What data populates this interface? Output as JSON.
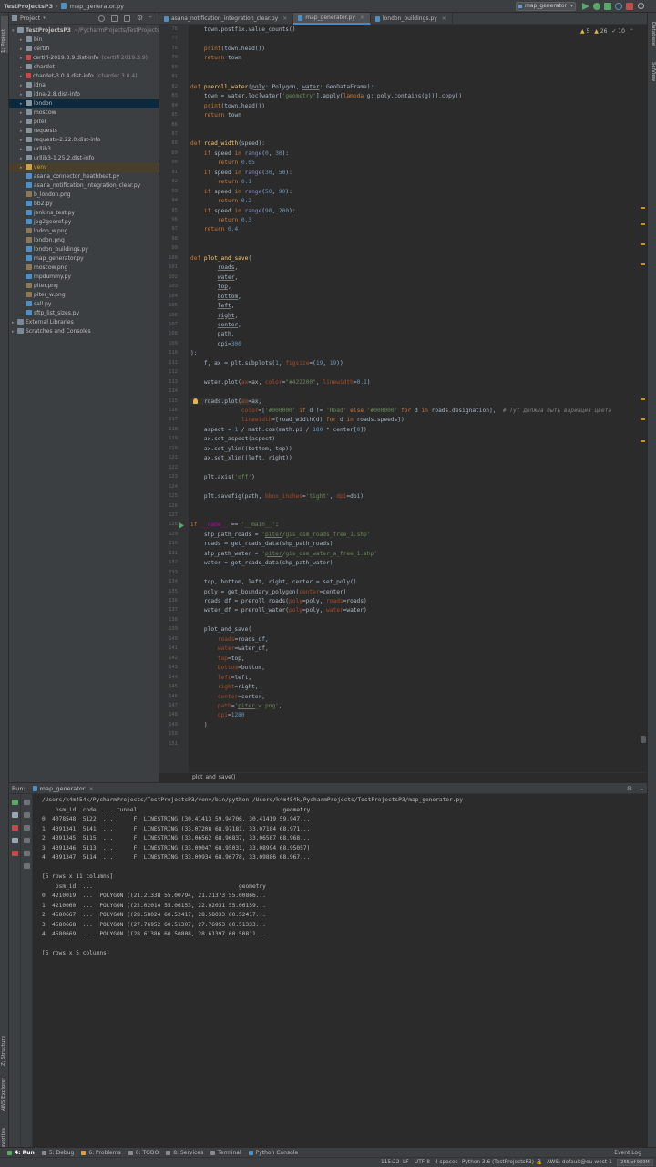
{
  "titlebar": {
    "project": "TestProjectsP3",
    "file": "map_generator.py",
    "run_config": "map_generator"
  },
  "left_tabs": {
    "project": "1: Project",
    "structure": "Z: Structure",
    "aws": "AWS Explorer",
    "favorites": "2: Favorites"
  },
  "right_tabs": {
    "database": "Database",
    "sciview": "SciView"
  },
  "project_panel": {
    "title": "Project",
    "items": [
      {
        "label": "TestProjectsP3",
        "extra": "~/PycharmProjects/TestProjectsP3",
        "kind": "folder",
        "depth": 0,
        "arrow": "▾"
      },
      {
        "label": "bin",
        "extra": "",
        "kind": "folder",
        "depth": 1,
        "arrow": "▸"
      },
      {
        "label": "certifi",
        "extra": "",
        "kind": "folder",
        "depth": 1,
        "arrow": "▸"
      },
      {
        "label": "certifi-2019.3.9.dist-info",
        "extra": "(certifi 2019.3.9)",
        "kind": "red",
        "depth": 1,
        "arrow": "▸"
      },
      {
        "label": "chardet",
        "extra": "",
        "kind": "folder",
        "depth": 1,
        "arrow": "▸"
      },
      {
        "label": "chardet-3.0.4.dist-info",
        "extra": "(chardet 3.0.4)",
        "kind": "red",
        "depth": 1,
        "arrow": "▸"
      },
      {
        "label": "idna",
        "extra": "",
        "kind": "folder",
        "depth": 1,
        "arrow": "▸"
      },
      {
        "label": "idna-2.8.dist-info",
        "extra": "",
        "kind": "folder",
        "depth": 1,
        "arrow": "▸"
      },
      {
        "label": "london",
        "extra": "",
        "kind": "folder",
        "depth": 1,
        "arrow": "▸",
        "selected": true
      },
      {
        "label": "moscow",
        "extra": "",
        "kind": "folder",
        "depth": 1,
        "arrow": "▸"
      },
      {
        "label": "piter",
        "extra": "",
        "kind": "folder",
        "depth": 1,
        "arrow": "▸"
      },
      {
        "label": "requests",
        "extra": "",
        "kind": "folder",
        "depth": 1,
        "arrow": "▸"
      },
      {
        "label": "requests-2.22.0.dist-info",
        "extra": "",
        "kind": "folder",
        "depth": 1,
        "arrow": "▸"
      },
      {
        "label": "urllib3",
        "extra": "",
        "kind": "folder",
        "depth": 1,
        "arrow": "▸"
      },
      {
        "label": "urllib3-1.25.2.dist-info",
        "extra": "",
        "kind": "folder",
        "depth": 1,
        "arrow": "▸"
      },
      {
        "label": "venv",
        "extra": "",
        "kind": "venv",
        "depth": 1,
        "arrow": "▸",
        "highlight": true
      },
      {
        "label": "asana_connector_heathbeat.py",
        "extra": "",
        "kind": "py",
        "depth": 1,
        "arrow": ""
      },
      {
        "label": "asana_notification_integration_clear.py",
        "extra": "",
        "kind": "py",
        "depth": 1,
        "arrow": ""
      },
      {
        "label": "b_london.png",
        "extra": "",
        "kind": "png",
        "depth": 1,
        "arrow": ""
      },
      {
        "label": "bb2.py",
        "extra": "",
        "kind": "py",
        "depth": 1,
        "arrow": ""
      },
      {
        "label": "jenkins_test.py",
        "extra": "",
        "kind": "py",
        "depth": 1,
        "arrow": ""
      },
      {
        "label": "jpg2georef.py",
        "extra": "",
        "kind": "py",
        "depth": 1,
        "arrow": ""
      },
      {
        "label": "lndon_w.png",
        "extra": "",
        "kind": "png",
        "depth": 1,
        "arrow": ""
      },
      {
        "label": "london.png",
        "extra": "",
        "kind": "png",
        "depth": 1,
        "arrow": ""
      },
      {
        "label": "london_buildings.py",
        "extra": "",
        "kind": "py",
        "depth": 1,
        "arrow": ""
      },
      {
        "label": "map_generator.py",
        "extra": "",
        "kind": "py",
        "depth": 1,
        "arrow": ""
      },
      {
        "label": "moscow.png",
        "extra": "",
        "kind": "png",
        "depth": 1,
        "arrow": ""
      },
      {
        "label": "mpdummy.py",
        "extra": "",
        "kind": "py",
        "depth": 1,
        "arrow": ""
      },
      {
        "label": "piter.png",
        "extra": "",
        "kind": "png",
        "depth": 1,
        "arrow": ""
      },
      {
        "label": "piter_w.png",
        "extra": "",
        "kind": "png",
        "depth": 1,
        "arrow": ""
      },
      {
        "label": "sall.py",
        "extra": "",
        "kind": "py",
        "depth": 1,
        "arrow": ""
      },
      {
        "label": "sftp_list_sizes.py",
        "extra": "",
        "kind": "py",
        "depth": 1,
        "arrow": ""
      },
      {
        "label": "External Libraries",
        "extra": "",
        "kind": "libs",
        "depth": 0,
        "arrow": "▸"
      },
      {
        "label": "Scratches and Consoles",
        "extra": "",
        "kind": "libs",
        "depth": 0,
        "arrow": "▸"
      }
    ]
  },
  "editor_tabs": [
    {
      "label": "asana_notification_integration_clear.py",
      "active": false
    },
    {
      "label": "map_generator.py",
      "active": true
    },
    {
      "label": "london_buildings.py",
      "active": false
    }
  ],
  "inspections": {
    "warnings": "5",
    "weak": "26",
    "typos": "10"
  },
  "code_lines": [
    {
      "n": "76",
      "h": "    town.postfix.value_counts()"
    },
    {
      "n": "77",
      "h": ""
    },
    {
      "n": "78",
      "h": "    <span class='kw'>print</span>(town.head())"
    },
    {
      "n": "79",
      "h": "    <span class='kw'>return</span> town"
    },
    {
      "n": "80",
      "h": ""
    },
    {
      "n": "81",
      "h": ""
    },
    {
      "n": "82",
      "h": "<span class='kw'>def</span> <span class='fn'>preroll_water</span>(<span class='pu'>poly</span>: Polygon, <span class='pu'>water</span>: GeoDataFrame):"
    },
    {
      "n": "83",
      "h": "    town = water.loc[water[<span class='str'>'geometry'</span>].apply(<span class='kw'>lambda</span> g: poly.contains(g))].copy()"
    },
    {
      "n": "84",
      "h": "    <span class='kw'>print</span>(town.head())"
    },
    {
      "n": "85",
      "h": "    <span class='kw'>return</span> town"
    },
    {
      "n": "86",
      "h": ""
    },
    {
      "n": "87",
      "h": ""
    },
    {
      "n": "88",
      "h": "<span class='kw'>def</span> <span class='fn'>road_width</span>(speed):"
    },
    {
      "n": "89",
      "h": "    <span class='kw'>if</span> speed <span class='kw'>in</span> <span class='bi'>range</span>(<span class='num'>0</span>, <span class='num'>30</span>):"
    },
    {
      "n": "90",
      "h": "        <span class='kw'>return</span> <span class='num'>0.05</span>"
    },
    {
      "n": "91",
      "h": "    <span class='kw'>if</span> speed <span class='kw'>in</span> <span class='bi'>range</span>(<span class='num'>30</span>, <span class='num'>50</span>):"
    },
    {
      "n": "92",
      "h": "        <span class='kw'>return</span> <span class='num'>0.1</span>"
    },
    {
      "n": "93",
      "h": "    <span class='kw'>if</span> speed <span class='kw'>in</span> <span class='bi'>range</span>(<span class='num'>50</span>, <span class='num'>90</span>):"
    },
    {
      "n": "94",
      "h": "        <span class='kw'>return</span> <span class='num'>0.2</span>"
    },
    {
      "n": "95",
      "h": "    <span class='kw'>if</span> speed <span class='kw'>in</span> <span class='bi'>range</span>(<span class='num'>90</span>, <span class='num'>200</span>):"
    },
    {
      "n": "96",
      "h": "        <span class='kw'>return</span> <span class='num'>0.3</span>"
    },
    {
      "n": "97",
      "h": "    <span class='kw'>return</span> <span class='num'>0.4</span>"
    },
    {
      "n": "98",
      "h": ""
    },
    {
      "n": "99",
      "h": ""
    },
    {
      "n": "100",
      "h": "<span class='kw'>def</span> <span class='fn'>plot_and_save</span>("
    },
    {
      "n": "101",
      "h": "        <span class='pu'>roads</span>,"
    },
    {
      "n": "102",
      "h": "        <span class='pu'>water</span>,"
    },
    {
      "n": "103",
      "h": "        <span class='pu'>top</span>,"
    },
    {
      "n": "104",
      "h": "        <span class='pu'>bottom</span>,"
    },
    {
      "n": "105",
      "h": "        <span class='pu'>left</span>,"
    },
    {
      "n": "106",
      "h": "        <span class='pu'>right</span>,"
    },
    {
      "n": "107",
      "h": "        <span class='pu'>center</span>,"
    },
    {
      "n": "108",
      "h": "        path,"
    },
    {
      "n": "109",
      "h": "        dpi=<span class='num'>300</span>"
    },
    {
      "n": "110",
      "h": "):"
    },
    {
      "n": "111",
      "h": "    f, ax = plt.subplots(<span class='num'>1</span>, <span class='prm'>figsize</span>=(<span class='num'>19</span>, <span class='num'>19</span>))"
    },
    {
      "n": "112",
      "h": ""
    },
    {
      "n": "113",
      "h": "    water.plot(<span class='prm'>ax</span>=ax, <span class='prm'>color</span>=<span class='str'>\"#422200\"</span>, <span class='prm'>linewidth</span>=<span class='num'>0.1</span>)"
    },
    {
      "n": "114",
      "h": ""
    },
    {
      "n": "115",
      "h": "    roads.plot(<span class='prm'>ax</span>=ax,"
    },
    {
      "n": "116",
      "h": "               <span class='prm'>color</span>=[<span class='str'>'#000000'</span> <span class='kw'>if</span> d != <span class='str'>'Road'</span> <span class='kw'>else</span> <span class='str'>'#000000'</span> <span class='kw'>for</span> d <span class='kw'>in</span> roads.designation],  <span class='cmt'># Тут должна быть вариация цвета</span>"
    },
    {
      "n": "117",
      "h": "               <span class='prm'>linewidth</span>=[road_width(d) <span class='kw'>for</span> d <span class='kw'>in</span> roads.speeds])"
    },
    {
      "n": "118",
      "h": "    aspect = <span class='num'>1</span> / math.cos(math.pi / <span class='num'>180</span> * center[<span class='num'>0</span>])"
    },
    {
      "n": "119",
      "h": "    ax.set_aspect(aspect)"
    },
    {
      "n": "120",
      "h": "    ax.set_ylim((bottom, top))"
    },
    {
      "n": "121",
      "h": "    ax.set_xlim((left, right))"
    },
    {
      "n": "122",
      "h": ""
    },
    {
      "n": "123",
      "h": "    plt.axis(<span class='str'>'off'</span>)"
    },
    {
      "n": "124",
      "h": ""
    },
    {
      "n": "125",
      "h": "    plt.savefig(path, <span class='prm'>bbox_inches</span>=<span class='str'>'tight'</span>, <span class='prm'>dpi</span>=dpi)"
    },
    {
      "n": "126",
      "h": ""
    },
    {
      "n": "127",
      "h": ""
    },
    {
      "n": "128",
      "h": "<span class='kw'>if</span> <span class='dunder'>__name__</span> == <span class='str'>'__main__'</span>:"
    },
    {
      "n": "129",
      "h": "    shp_path_roads = <span class='str'>'<span class=\"pu\">piter</span>/gis_osm_roads_free_1.shp'</span>"
    },
    {
      "n": "130",
      "h": "    roads = get_roads_data(shp_path_roads)"
    },
    {
      "n": "131",
      "h": "    shp_path_water = <span class='str'>'<span class=\"pu\">piter</span>/gis_osm_water_a_free_1.shp'</span>"
    },
    {
      "n": "132",
      "h": "    water = get_roads_data(shp_path_water)"
    },
    {
      "n": "133",
      "h": ""
    },
    {
      "n": "134",
      "h": "    top, bottom, left, right, center = set_poly()"
    },
    {
      "n": "135",
      "h": "    poly = get_boundary_polygon(<span class='prm'>center</span>=center)"
    },
    {
      "n": "136",
      "h": "    roads_df = preroll_roads(<span class='prm'>poly</span>=poly, <span class='prm'>roads</span>=roads)"
    },
    {
      "n": "137",
      "h": "    water_df = preroll_water(<span class='prm'>poly</span>=poly, <span class='prm'>water</span>=water)"
    },
    {
      "n": "138",
      "h": ""
    },
    {
      "n": "139",
      "h": "    plot_and_save("
    },
    {
      "n": "140",
      "h": "        <span class='prm'>roads</span>=roads_df,"
    },
    {
      "n": "141",
      "h": "        <span class='prm'>water</span>=water_df,"
    },
    {
      "n": "142",
      "h": "        <span class='prm'>top</span>=top,"
    },
    {
      "n": "143",
      "h": "        <span class='prm'>bottom</span>=bottom,"
    },
    {
      "n": "144",
      "h": "        <span class='prm'>left</span>=left,"
    },
    {
      "n": "145",
      "h": "        <span class='prm'>right</span>=right,"
    },
    {
      "n": "146",
      "h": "        <span class='prm'>center</span>=center,"
    },
    {
      "n": "147",
      "h": "        <span class='prm'>path</span>=<span class='str'>'<span class=\"pu\">piter</span>_w.png'</span>,"
    },
    {
      "n": "148",
      "h": "        <span class='prm'>dpi</span>=<span class='num'>1280</span>"
    },
    {
      "n": "149",
      "h": "    )"
    },
    {
      "n": "150",
      "h": ""
    },
    {
      "n": "151",
      "h": ""
    }
  ],
  "breadcrumb": "plot_and_save()",
  "run_panel": {
    "label": "Run:",
    "tab": "map_generator"
  },
  "console_lines": [
    "/Users/k4m454k/PycharmProjects/TestProjectsP3/venv/bin/python /Users/k4m454k/PycharmProjects/TestProjectsP3/map_generator.py",
    "    osm_id  code  ... tunnel                                           geometry",
    "0  4078548  5122  ...      F  LINESTRING (30.41413 59.94706, 30.41419 59.947...",
    "1  4391341  5141  ...      F  LINESTRING (33.07208 68.97181, 33.07184 68.971...",
    "2  4391345  5115  ...      F  LINESTRING (33.06562 68.96837, 33.06587 68.968...",
    "3  4391346  5113  ...      F  LINESTRING (33.09047 68.95031, 33.08994 68.95057)",
    "4  4391347  5114  ...      F  LINESTRING (33.09934 68.96778, 33.09886 68.967...",
    "",
    "[5 rows x 11 columns]",
    "    osm_id  ...                                           geometry",
    "0  4210019  ...  POLYGON ((21.21338 55.00794, 21.21373 55.00866...",
    "1  4210060  ...  POLYGON ((22.02014 55.06153, 22.02031 55.06159...",
    "2  4580667  ...  POLYGON ((28.58024 60.52417, 28.58033 60.52417...",
    "3  4580668  ...  POLYGON ((27.76952 60.51307, 27.76953 60.51333...",
    "4  4580669  ...  POLYGON ((28.61386 60.50808, 28.61397 60.50811...",
    "",
    "[5 rows x 5 columns]"
  ],
  "bottom_tools": [
    {
      "label": "4: Run",
      "active": true,
      "color": "#59a869"
    },
    {
      "label": "5: Debug",
      "active": false,
      "color": "#8a8a8a"
    },
    {
      "label": "6: Problems",
      "active": false,
      "color": "#d9a343"
    },
    {
      "label": "6: TODO",
      "active": false,
      "color": "#8a8a8a"
    },
    {
      "label": "8: Services",
      "active": false,
      "color": "#8a8a8a"
    },
    {
      "label": "Terminal",
      "active": false,
      "color": "#8a8a8a"
    },
    {
      "label": "Python Console",
      "active": false,
      "color": "#4f8fc4"
    }
  ],
  "event_log": "Event Log",
  "status": {
    "position": "115:22",
    "line_sep": "LF",
    "encoding": "UTF-8",
    "indent": "4 spaces",
    "interpreter": "Python 3.6 (TestProjectsP3)",
    "aws": "AWS: default@eu-west-1",
    "memory": "265 of 989M"
  }
}
